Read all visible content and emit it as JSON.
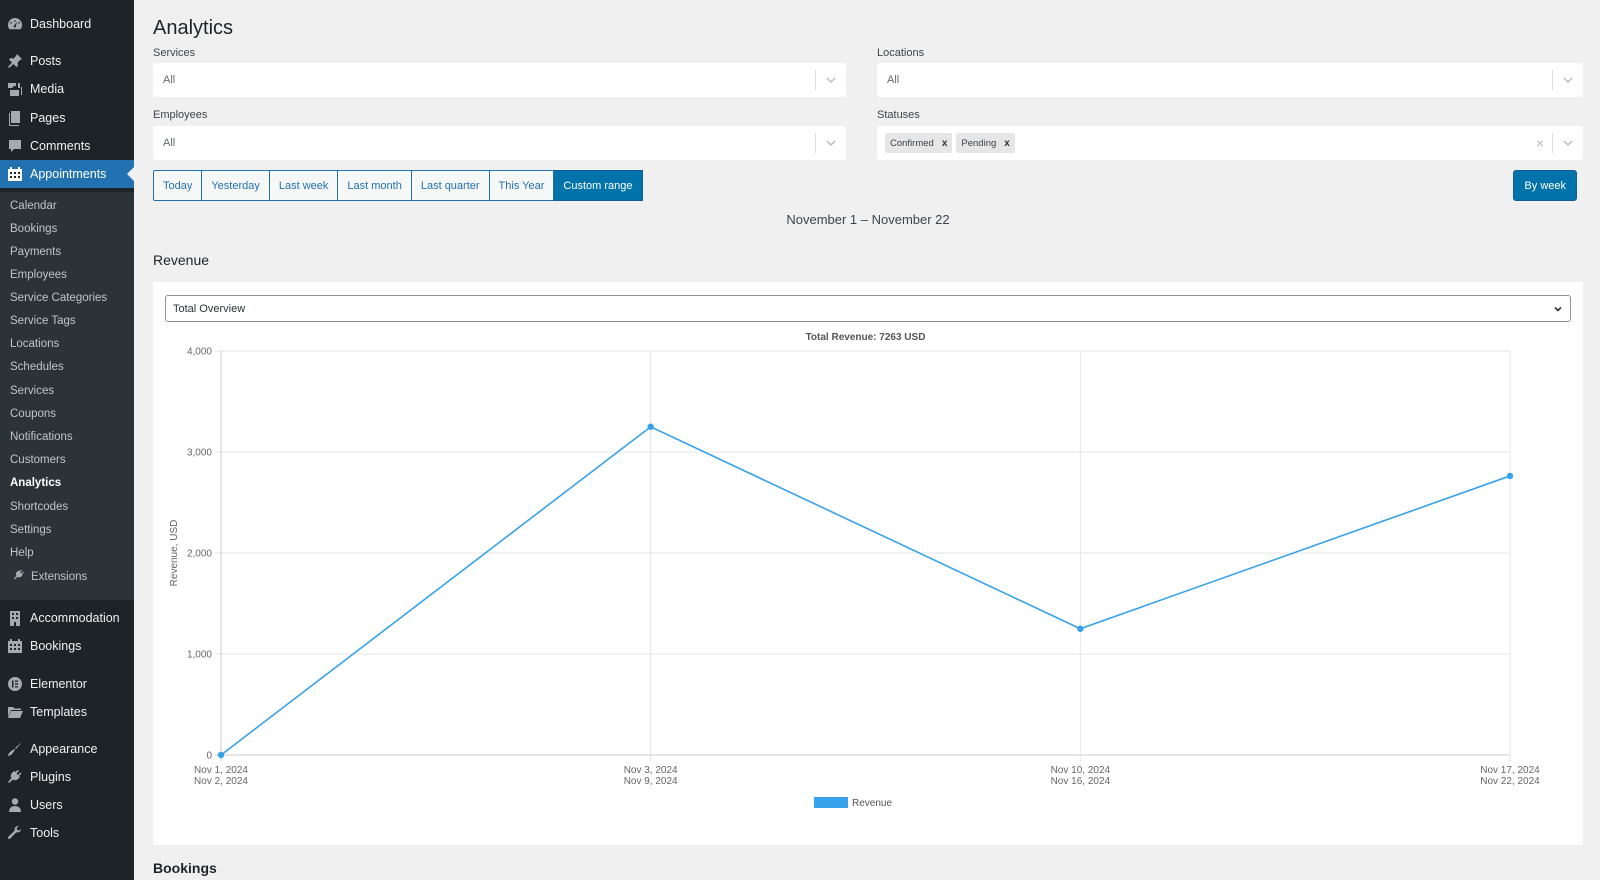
{
  "sidebar": {
    "top_items": [
      {
        "label": "Dashboard",
        "icon": "dashboard-icon"
      },
      {
        "label": "Posts",
        "icon": "pin-icon"
      },
      {
        "label": "Media",
        "icon": "media-icon"
      },
      {
        "label": "Pages",
        "icon": "pages-icon"
      },
      {
        "label": "Comments",
        "icon": "comment-icon"
      },
      {
        "label": "Appointments",
        "icon": "calendar-icon",
        "active": true
      }
    ],
    "submenu": [
      {
        "label": "Calendar"
      },
      {
        "label": "Bookings"
      },
      {
        "label": "Payments"
      },
      {
        "label": "Employees"
      },
      {
        "label": "Service Categories"
      },
      {
        "label": "Service Tags"
      },
      {
        "label": "Locations"
      },
      {
        "label": "Schedules"
      },
      {
        "label": "Services"
      },
      {
        "label": "Coupons"
      },
      {
        "label": "Notifications"
      },
      {
        "label": "Customers"
      },
      {
        "label": "Analytics",
        "current": true
      },
      {
        "label": "Shortcodes"
      },
      {
        "label": "Settings"
      },
      {
        "label": "Help"
      },
      {
        "label": "Extensions",
        "icon": "plugin-icon"
      }
    ],
    "bottom_items": [
      {
        "label": "Accommodation",
        "icon": "building-icon"
      },
      {
        "label": "Bookings",
        "icon": "calendar-icon"
      },
      {
        "label": "Elementor",
        "icon": "elementor-icon"
      },
      {
        "label": "Templates",
        "icon": "folder-icon"
      },
      {
        "label": "Appearance",
        "icon": "brush-icon"
      },
      {
        "label": "Plugins",
        "icon": "plugin-icon"
      },
      {
        "label": "Users",
        "icon": "user-icon"
      },
      {
        "label": "Tools",
        "icon": "wrench-icon"
      }
    ]
  },
  "page": {
    "title": "Analytics",
    "filters": {
      "services": {
        "label": "Services",
        "value": "All"
      },
      "locations": {
        "label": "Locations",
        "value": "All"
      },
      "employees": {
        "label": "Employees",
        "value": "All"
      },
      "statuses": {
        "label": "Statuses",
        "tags": [
          "Confirmed",
          "Pending"
        ]
      }
    },
    "range_buttons": [
      {
        "label": "Today"
      },
      {
        "label": "Yesterday"
      },
      {
        "label": "Last week"
      },
      {
        "label": "Last month"
      },
      {
        "label": "Last quarter"
      },
      {
        "label": "This Year"
      },
      {
        "label": "Custom range",
        "active": true
      }
    ],
    "group_button": "By week",
    "date_range": "November 1 – November 22",
    "revenue_heading": "Revenue",
    "overview_select": "Total Overview",
    "next_heading": "Bookings"
  },
  "colors": {
    "accent": "#0073aa",
    "sidebar_bg": "#1d2327",
    "submenu_bg": "#2c3338",
    "active_menu": "#2271b1",
    "series": "#36a2eb"
  },
  "chart_data": {
    "type": "line",
    "title": "Total Revenue: 7263 USD",
    "xlabel": "",
    "ylabel": "Revenue, USD",
    "categories": [
      [
        "Nov 1, 2024",
        "Nov 2, 2024"
      ],
      [
        "Nov 3, 2024",
        "Nov 9, 2024"
      ],
      [
        "Nov 10, 2024",
        "Nov 16, 2024"
      ],
      [
        "Nov 17, 2024",
        "Nov 22, 2024"
      ]
    ],
    "series": [
      {
        "name": "Revenue",
        "values": [
          0,
          3250,
          1250,
          2763
        ]
      }
    ],
    "ylim": [
      0,
      4000
    ],
    "yticks": [
      0,
      1000,
      2000,
      3000,
      4000
    ],
    "ytick_labels": [
      "0",
      "1,000",
      "2,000",
      "3,000",
      "4,000"
    ],
    "grid": true,
    "legend": "bottom-center"
  }
}
